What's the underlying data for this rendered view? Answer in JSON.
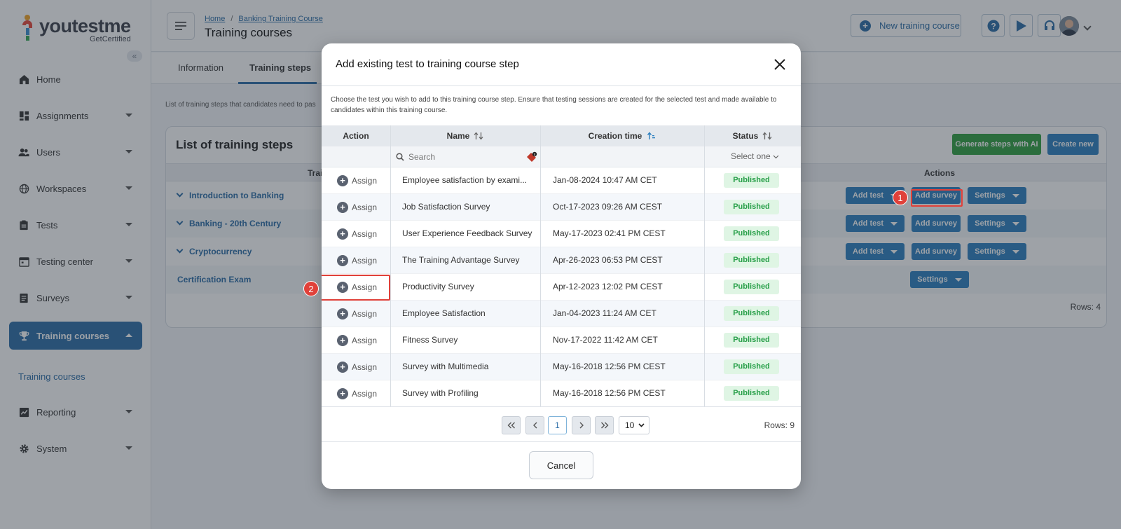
{
  "logo": {
    "brand": "youtestme",
    "tagline": "GetCertified"
  },
  "sidebar": {
    "collapse_label": "«",
    "items": [
      {
        "label": "Home",
        "icon": "home-icon",
        "has_caret": false
      },
      {
        "label": "Assignments",
        "icon": "assignments-icon",
        "has_caret": true
      },
      {
        "label": "Users",
        "icon": "users-icon",
        "has_caret": true
      },
      {
        "label": "Workspaces",
        "icon": "globe-icon",
        "has_caret": true
      },
      {
        "label": "Tests",
        "icon": "tests-icon",
        "has_caret": true
      },
      {
        "label": "Testing center",
        "icon": "calendar-icon",
        "has_caret": true
      },
      {
        "label": "Surveys",
        "icon": "surveys-icon",
        "has_caret": true
      },
      {
        "label": "Training courses",
        "icon": "trophy-icon",
        "has_caret": true,
        "active": true
      },
      {
        "label": "Reporting",
        "icon": "reporting-icon",
        "has_caret": true
      },
      {
        "label": "System",
        "icon": "gear-icon",
        "has_caret": true
      }
    ],
    "sub_item": "Training courses"
  },
  "header": {
    "breadcrumb": [
      "Home",
      "Banking Training Course"
    ],
    "breadcrumb_sep": "/",
    "title": "Training courses",
    "new_course_label": "New training course"
  },
  "tabs": [
    {
      "label": "Information",
      "active": false
    },
    {
      "label": "Training steps",
      "active": true
    }
  ],
  "content_desc": "List of training steps that candidates need to pas",
  "steps_card": {
    "title": "List of training steps",
    "generate_label": "Generate steps with AI",
    "create_label": "Create new",
    "col_steps": "Trai",
    "col_actions": "Actions",
    "rows": [
      {
        "name": "Introduction to Banking",
        "group": true,
        "buttons": [
          "Add test",
          "Add survey",
          "Settings"
        ]
      },
      {
        "name": "Banking - 20th Century",
        "group": true,
        "buttons": [
          "Add test",
          "Add survey",
          "Settings"
        ]
      },
      {
        "name": "Cryptocurrency",
        "group": true,
        "buttons": [
          "Add test",
          "Add survey",
          "Settings"
        ]
      },
      {
        "name": "Certification Exam",
        "group": false,
        "buttons": [
          "Settings"
        ]
      }
    ],
    "rows_count": "Rows: 4"
  },
  "callouts": {
    "one": "1",
    "two": "2"
  },
  "modal": {
    "title": "Add existing test to training course step",
    "description": "Choose the test you wish to add to this training course step. Ensure that testing sessions are created for the selected test and made available to candidates within this training course.",
    "columns": {
      "action": "Action",
      "name": "Name",
      "creation_time": "Creation time",
      "status": "Status"
    },
    "search_placeholder": "Search",
    "status_filter": "Select one",
    "assign_label": "Assign",
    "rows": [
      {
        "name": "Employee satisfaction by exami...",
        "time": "Jan-08-2024 10:47 AM CET",
        "status": "Published"
      },
      {
        "name": "Job Satisfaction Survey",
        "time": "Oct-17-2023 09:26 AM CEST",
        "status": "Published"
      },
      {
        "name": "User Experience Feedback Survey",
        "time": "May-17-2023 02:41 PM CEST",
        "status": "Published"
      },
      {
        "name": "The Training Advantage Survey",
        "time": "Apr-26-2023 06:53 PM CEST",
        "status": "Published"
      },
      {
        "name": "Productivity Survey",
        "time": "Apr-12-2023 12:02 PM CEST",
        "status": "Published"
      },
      {
        "name": "Employee Satisfaction",
        "time": "Jan-04-2023 11:24 AM CET",
        "status": "Published"
      },
      {
        "name": "Fitness Survey",
        "time": "Nov-17-2022 11:42 AM CET",
        "status": "Published"
      },
      {
        "name": "Survey with Multimedia",
        "time": "May-16-2018 12:56 PM CEST",
        "status": "Published"
      },
      {
        "name": "Survey with Profiling",
        "time": "May-16-2018 12:56 PM CEST",
        "status": "Published"
      }
    ],
    "pager": {
      "current_page": "1",
      "page_size": "10",
      "rows": "Rows: 9"
    },
    "cancel_label": "Cancel"
  },
  "colors": {
    "primary": "#2a6ca6",
    "button": "#2a7fbf",
    "ai_button": "#2e9e3e",
    "published_bg": "#dff5e4",
    "published_text": "#29a04a",
    "highlight": "#e0413a"
  }
}
